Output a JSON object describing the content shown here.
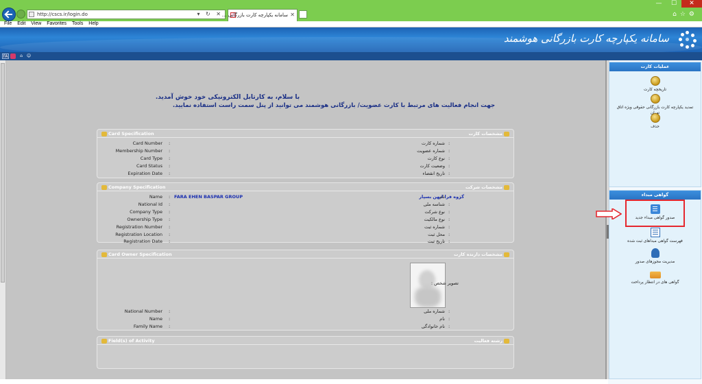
{
  "browser": {
    "url": "http://cscs.ir/login.do",
    "tab_title": "سامانه یکپارچه کارت بازرگانی ...",
    "address_controls": "▾ ↻ ✕",
    "menu": [
      "File",
      "Edit",
      "View",
      "Favorites",
      "Tools",
      "Help"
    ]
  },
  "header": {
    "title": "سامانه یکپارچه کارت بازرگانی هوشمند"
  },
  "toolbar": {
    "lang": "FA"
  },
  "welcome": {
    "line1": "با سلام، به کارتابل الکترونیکی خود خوش آمدید.",
    "line2": "جهت انجام فعالیت های مرتبط با کارت عضویت/ بازرگانی هوشمند می توانید از پنل سمت راست استفاده نمایید."
  },
  "card_spec": {
    "title_en": "Card Specification",
    "title_fa": "مشخصات کارت",
    "rows": [
      {
        "en": "Card Number",
        "fa": "شماره کارت"
      },
      {
        "en": "Membership Number",
        "fa": "شماره عضویت"
      },
      {
        "en": "Card Type",
        "fa": "نوع کارت"
      },
      {
        "en": "Card Status",
        "fa": "وضعیت کارت"
      },
      {
        "en": "Expiration Date",
        "fa": "تاریخ انقضاء"
      }
    ]
  },
  "company_spec": {
    "title_en": "Company Specification",
    "title_fa": "مشخصات شرکت",
    "rows": [
      {
        "en": "Name",
        "fa": "نام",
        "value_en": "FARA EHEN BASPAR GROUP",
        "value_fa": "گروه فرا ایهن بسپار"
      },
      {
        "en": "National Id",
        "fa": "شناسه ملی"
      },
      {
        "en": "Company Type",
        "fa": "نوع شرکت"
      },
      {
        "en": "Ownership Type",
        "fa": "نوع مالکیت"
      },
      {
        "en": "Registration Number",
        "fa": "شماره ثبت"
      },
      {
        "en": "Registration Location",
        "fa": "محل ثبت"
      },
      {
        "en": "Registration Date",
        "fa": "تاریخ ثبت"
      }
    ]
  },
  "owner_spec": {
    "title_en": "Card Owner Specification",
    "title_fa": "مشخصات دارنده کارت",
    "photo_label": "تصویر شخص :",
    "rows": [
      {
        "en": "National Number",
        "fa": "شماره ملی"
      },
      {
        "en": "Name",
        "fa": "نام"
      },
      {
        "en": "Family Name",
        "fa": "نام خانوادگی"
      }
    ]
  },
  "activity": {
    "title_en": "Field(s) of Activity",
    "title_fa": "رشته فعالیت"
  },
  "sidebar": {
    "group1": {
      "title": "عملیات کارت",
      "items": [
        "تاریخچه کارت",
        "تمدید یکپارچه کارت بازرگانی حقوقی ویژه اتاق تهران",
        "حذف"
      ]
    },
    "group2": {
      "title": "گواهی مبداء",
      "items": [
        "صدور گواهی مبداء جدید",
        "فهرست گواهی مبداهای ثبت شده",
        "مدیریت مجوزهای صدور",
        "گواهی های در انتظار پرداخت"
      ]
    }
  },
  "colors": {
    "accent_red": "#e5262d",
    "header_blue": "#1d63b5",
    "content_gray": "#c4c4c4",
    "value_blue": "#1a2fb0"
  }
}
